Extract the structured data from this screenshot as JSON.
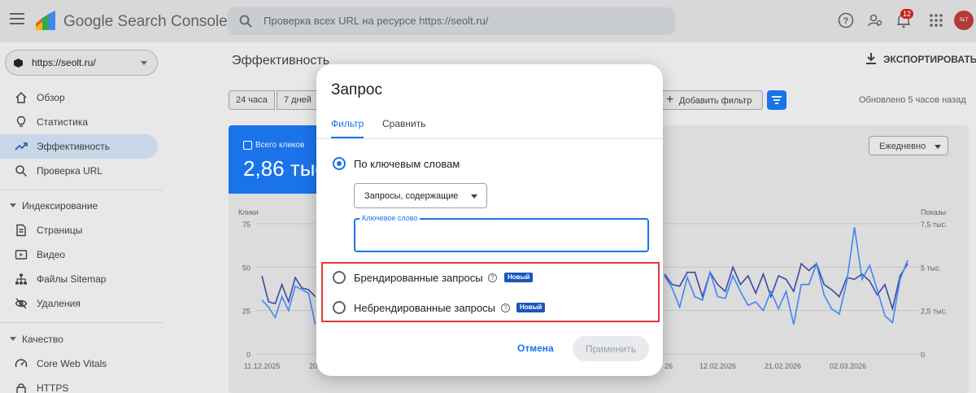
{
  "header": {
    "app_title": "Google Search Console",
    "search_placeholder": "Проверка всех URL на ресурсе https://seolt.ru/",
    "notifications_count": "12",
    "avatar_text": "SLT"
  },
  "sidebar": {
    "property": "https://seolt.ru/",
    "items": [
      {
        "label": "Обзор",
        "icon": "home-icon"
      },
      {
        "label": "Статистика",
        "icon": "lightbulb-icon"
      },
      {
        "label": "Эффективность",
        "icon": "trending-up-icon",
        "active": true
      },
      {
        "label": "Проверка URL",
        "icon": "search-icon"
      }
    ],
    "indexing": {
      "title": "Индексирование",
      "items": [
        {
          "label": "Страницы",
          "icon": "page-icon"
        },
        {
          "label": "Видео",
          "icon": "video-icon"
        },
        {
          "label": "Файлы Sitemap",
          "icon": "sitemap-icon"
        },
        {
          "label": "Удаления",
          "icon": "eye-off-icon"
        }
      ]
    },
    "quality": {
      "title": "Качество",
      "items": [
        {
          "label": "Core Web Vitals",
          "icon": "speed-icon"
        },
        {
          "label": "HTTPS",
          "icon": "lock-icon"
        }
      ]
    }
  },
  "main": {
    "page_title": "Эффективность",
    "export_label": "ЭКСПОРТИРОВАТЬ",
    "ranges": [
      "24 часа",
      "7 дней"
    ],
    "add_filter": "Добавить фильтр",
    "updated": "Обновлено 5 часов назад",
    "metric": {
      "label": "Всего кликов",
      "value": "2,86 тыс"
    },
    "granularity": "Ежедневно"
  },
  "chart_data": {
    "type": "line",
    "left_axis": {
      "label": "Клики",
      "ticks": [
        "75",
        "50",
        "25",
        "0"
      ],
      "range": [
        0,
        75
      ]
    },
    "right_axis": {
      "label": "Показы",
      "ticks": [
        "7,5 тыс.",
        "5 тыс.",
        "2,5 тыс.",
        "0"
      ],
      "range": [
        0,
        7500
      ]
    },
    "x_ticks": [
      "11.12.2025",
      "20",
      "26",
      "12.02.2026",
      "21.02.2026",
      "02.03.2026"
    ],
    "series": [
      {
        "color": "#3949ab",
        "values_visible_left": [
          45,
          30,
          29,
          40,
          30,
          44,
          38,
          37,
          33
        ],
        "values_visible_right": [
          46,
          40,
          39,
          47,
          47,
          33,
          47,
          40,
          36,
          50,
          40,
          45,
          35,
          46,
          33,
          45,
          43,
          36,
          52,
          48,
          52,
          40,
          37,
          33,
          44,
          43,
          46,
          42,
          34,
          40,
          26,
          45,
          52
        ]
      },
      {
        "color": "#4285f4",
        "values_visible_left": [
          31,
          27,
          21,
          33,
          25,
          39,
          37,
          35,
          17
        ],
        "values_visible_right": [
          45,
          38,
          27,
          44,
          33,
          31,
          47,
          33,
          32,
          45,
          36,
          28,
          30,
          25,
          36,
          26,
          36,
          17,
          40,
          40,
          52,
          34,
          26,
          23,
          42,
          73,
          43,
          51,
          37,
          22,
          18,
          43,
          54
        ]
      }
    ]
  },
  "dialog": {
    "title": "Запрос",
    "tabs": [
      "Фильтр",
      "Сравнить"
    ],
    "option_keywords": "По ключевым словам",
    "select_value": "Запросы, содержащие",
    "keyword_label": "Ключевое слово",
    "keyword_value": "",
    "option_branded": "Брендированные запросы",
    "option_nonbranded": "Небрендированные запросы",
    "new_badge": "Новый",
    "cancel": "Отмена",
    "apply": "Применить"
  }
}
